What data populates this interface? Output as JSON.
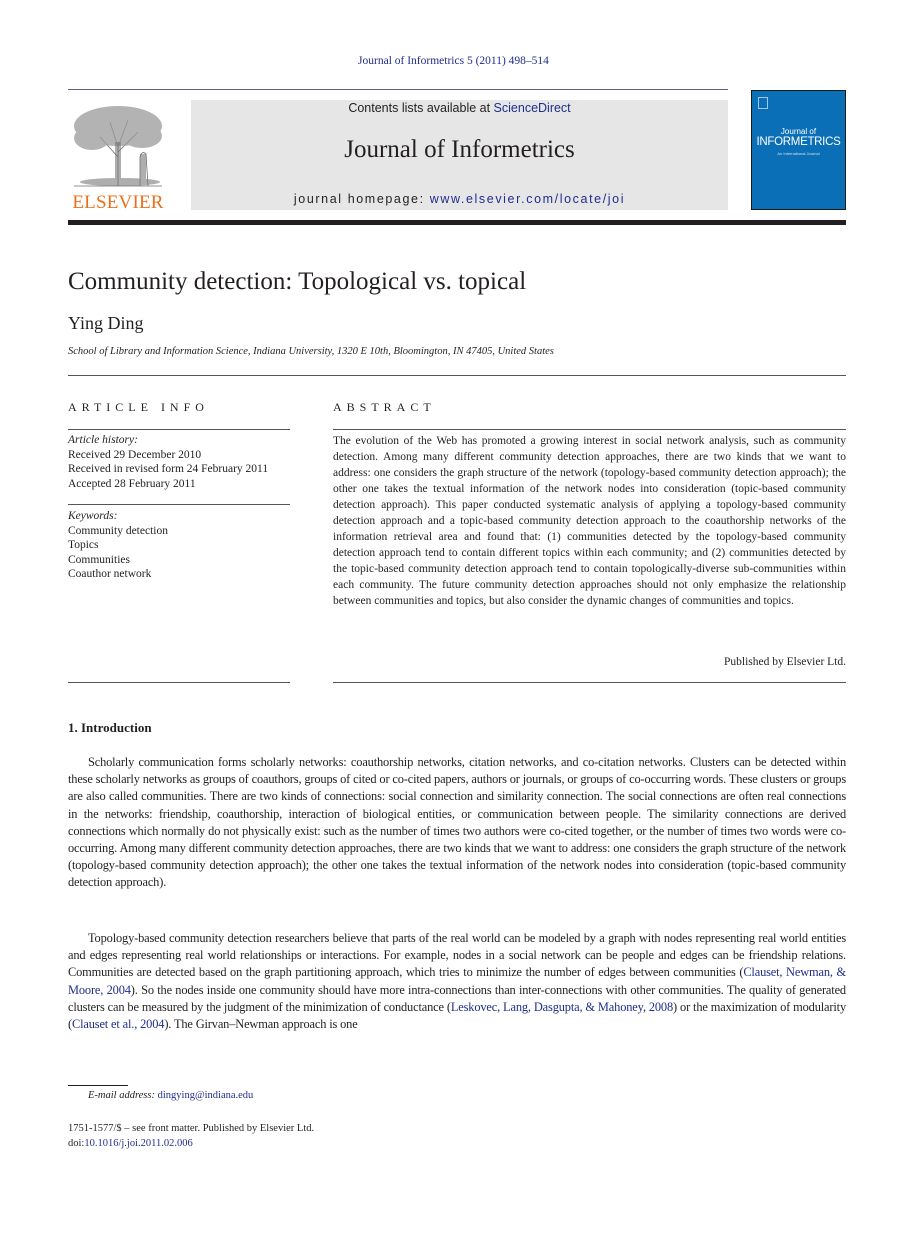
{
  "running_head": "Journal of Informetrics 5 (2011) 498–514",
  "publisher": {
    "logo_word": "ELSEVIER"
  },
  "masthead": {
    "contents_prefix": "Contents lists available at ",
    "contents_link": "ScienceDirect",
    "journal_name": "Journal of Informetrics",
    "homepage_prefix": "journal homepage: ",
    "homepage_link": "www.elsevier.com/locate/joi"
  },
  "cover": {
    "line1": "Journal of",
    "line2": "INFORMETRICS",
    "line3": "An International Journal"
  },
  "article": {
    "title": "Community detection: Topological vs. topical",
    "author": "Ying Ding",
    "affiliation": "School of Library and Information Science, Indiana University, 1320 E 10th, Bloomington, IN 47405, United States"
  },
  "article_info": {
    "heading": "ARTICLE INFO",
    "history_label": "Article history:",
    "history": [
      "Received 29 December 2010",
      "Received in revised form 24 February 2011",
      "Accepted 28 February 2011"
    ],
    "keywords_label": "Keywords:",
    "keywords": [
      "Community detection",
      "Topics",
      "Communities",
      "Coauthor network"
    ]
  },
  "abstract": {
    "heading": "ABSTRACT",
    "text": "The evolution of the Web has promoted a growing interest in social network analysis, such as community detection. Among many different community detection approaches, there are two kinds that we want to address: one considers the graph structure of the network (topology-based community detection approach); the other one takes the textual information of the network nodes into consideration (topic-based community detection approach). This paper conducted systematic analysis of applying a topology-based community detection approach and a topic-based community detection approach to the coauthorship networks of the information retrieval area and found that: (1) communities detected by the topology-based community detection approach tend to contain different topics within each community; and (2) communities detected by the topic-based community detection approach tend to contain topologically-diverse sub-communities within each community. The future community detection approaches should not only emphasize the relationship between communities and topics, but also consider the dynamic changes of communities and topics.",
    "published_by": "Published by Elsevier Ltd."
  },
  "introduction": {
    "heading": "1.  Introduction",
    "p1": "Scholarly communication forms scholarly networks: coauthorship networks, citation networks, and co-citation networks. Clusters can be detected within these scholarly networks as groups of coauthors, groups of cited or co-cited papers, authors or journals, or groups of co-occurring words. These clusters or groups are also called communities. There are two kinds of connections: social connection and similarity connection. The social connections are often real connections in the networks: friendship, coauthorship, interaction of biological entities, or communication between people. The similarity connections are derived connections which normally do not physically exist: such as the number of times two authors were co-cited together, or the number of times two words were co-occurring. Among many different community detection approaches, there are two kinds that we want to address: one considers the graph structure of the network (topology-based community detection approach); the other one takes the textual information of the network nodes into consideration (topic-based community detection approach).",
    "p2_a": "Topology-based community detection researchers believe that parts of the real world can be modeled by a graph with nodes representing real world entities and edges representing real world relationships or interactions. For example, nodes in a social network can be people and edges can be friendship relations. Communities are detected based on the graph partitioning approach, which tries to minimize the number of edges between communities (",
    "cite1": "Clauset, Newman, & Moore, 2004",
    "p2_b": "). So the nodes inside one community should have more intra-connections than inter-connections with other communities. The quality of generated clusters can be measured by the judgment of the minimization of conductance (",
    "cite2": "Leskovec, Lang, Dasgupta, & Mahoney, 2008",
    "p2_c": ") or the maximization of modularity (",
    "cite3": "Clauset et al., 2004",
    "p2_d": "). The Girvan–Newman approach is one"
  },
  "footnote": {
    "label": "E-mail address: ",
    "email": "dingying@indiana.edu"
  },
  "front_matter": {
    "issn_line": "1751-1577/$ – see front matter. Published by Elsevier Ltd.",
    "doi_prefix": "doi:",
    "doi": "10.1016/j.joi.2011.02.006"
  },
  "colors": {
    "link": "#1f2e8c",
    "elsevier_orange": "#e9711c",
    "cover_blue": "#0a6fb6",
    "masthead_gray": "#e6e6e6"
  }
}
